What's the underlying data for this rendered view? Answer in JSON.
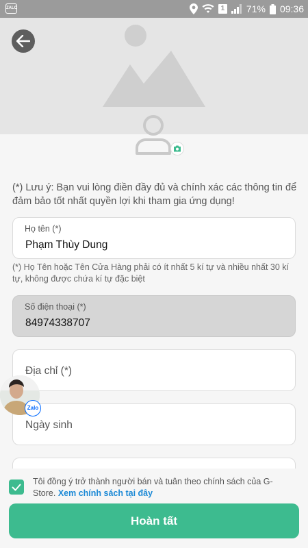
{
  "status_bar": {
    "app_icon_label": "ZALO",
    "sim_label": "1",
    "battery": "71%",
    "time": "09:36"
  },
  "header": {
    "back_icon": "arrow-left-icon",
    "cover_icon": "image-placeholder-icon"
  },
  "avatar": {
    "icon": "user-icon",
    "camera_icon": "camera-icon"
  },
  "note": "(*) Lưu ý: Bạn vui lòng điền đầy đủ và chính xác các thông tin để đảm bảo tốt nhất quyền lợi khi tham gia ứng dụng!",
  "form": {
    "name": {
      "label": "Họ tên (*)",
      "value": "Phạm Thùy Dung"
    },
    "name_hint": "(*) Họ Tên hoặc Tên Cửa Hàng phải có ít nhất 5 kí tự và nhiều nhất 30 kí tự, không được chứa kí tự đặc biệt",
    "phone": {
      "label": "Số điện thoại (*)",
      "value": "84974338707"
    },
    "address": {
      "placeholder": "Địa chỉ (*)"
    },
    "birthday": {
      "placeholder": "Ngày sinh"
    }
  },
  "chat_bubble": {
    "badge": "Zalo"
  },
  "agreement": {
    "checked": true,
    "text": "Tôi đồng ý trở thành người bán và tuân theo chính sách của G-Store. ",
    "link": "Xem chính sách tại đây"
  },
  "submit_label": "Hoàn tất",
  "colors": {
    "accent": "#3dbb8f",
    "link": "#1d8ad6",
    "status_bar": "#9b9b9b"
  }
}
